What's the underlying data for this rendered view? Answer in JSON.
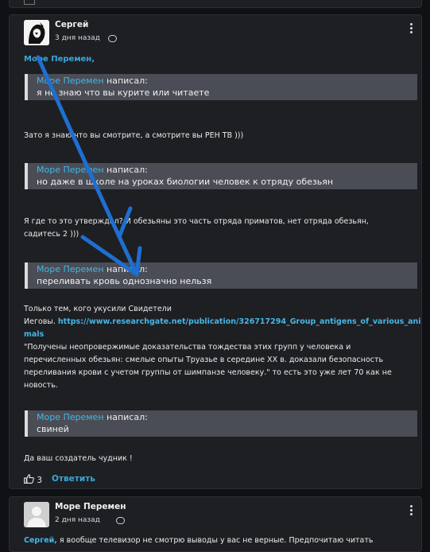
{
  "post1": {
    "author": "Сергей",
    "date": "3 дня назад",
    "mention": "Море Перемен,",
    "quote1": {
      "author": "Море Перемен",
      "wrote": "написал:",
      "text": "я не знаю что вы курите или читаете"
    },
    "para1": "Зато я знаю что вы смотрите, а смотрите вы РЕН ТВ )))",
    "quote2": {
      "author": "Море Перемен",
      "wrote": "написал:",
      "text": "но даже в школе на уроках биологии человек к отряду обезьян"
    },
    "para2_line1": "Я где то это утверждал? И обезьяны это часть отряда приматов, нет отряда обезьян,",
    "para2_line2": "садитесь 2 )))",
    "quote3": {
      "author": "Море Перемен",
      "wrote": "написал:",
      "text": "переливать кровь однозначно нельзя"
    },
    "para3_line1": "Только тем, кого укусили Свидетели",
    "para3_line2_prefix": "Иеговы. ",
    "para3_link_part1": "https://www.researchgate.net/publication/326717294_Group_antigens_of_various_ani",
    "para3_link_part2": "mals",
    "para3_line4": "\"Получены неопровержимые доказательства тождества этих групп у человека и",
    "para3_line5": "перечисленных обезьян: смелые опыты Труазье в середине XX в. доказали безопасность",
    "para3_line6": "переливания крови с учетом группы от шимпанзе человеку.\" то есть это уже лет 70 как не",
    "para3_line7": "новость.",
    "quote4": {
      "author": "Море Перемен",
      "wrote": "написал:",
      "text": "свиней"
    },
    "para4": "Да ваш создатель чудник !",
    "likes_count": "3",
    "reply_label": "Ответить"
  },
  "post2": {
    "author": "Море Перемен",
    "date": "2 дня назад",
    "mention": "Сергей,",
    "text_partial": "я вообще телевизор не смотрю выводы у вас не верные. Предпочитаю читать"
  },
  "colors": {
    "page_bg": "#101114",
    "card_bg": "#1e1f23",
    "quote_bg": "#4a4d55",
    "link": "#45b6e6",
    "annotation_arrow": "#1e6fd0"
  },
  "icons": [
    "comment-icon",
    "kebab-menu-icon",
    "thumbs-up-icon",
    "avatar-sketch",
    "avatar-default"
  ]
}
